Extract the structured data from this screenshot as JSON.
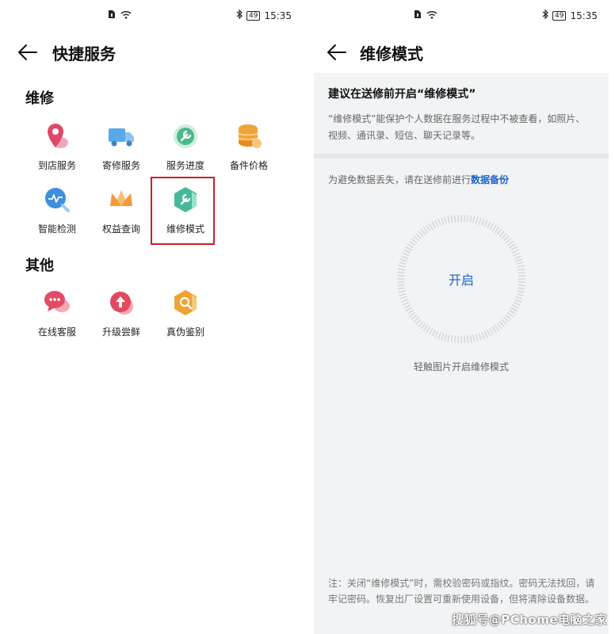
{
  "status_bar": {
    "time": "15:35",
    "battery": "49"
  },
  "left": {
    "title": "快捷服务",
    "sections": {
      "repair": {
        "title": "维修",
        "items": [
          "到店服务",
          "寄修服务",
          "服务进度",
          "备件价格",
          "智能检测",
          "权益查询",
          "维修模式"
        ]
      },
      "other": {
        "title": "其他",
        "items": [
          "在线客服",
          "升级尝鲜",
          "真伪鉴别"
        ]
      }
    }
  },
  "right": {
    "title": "维修模式",
    "headline": "建议在送修前开启“维修模式”",
    "description": "“维修模式”能保护个人数据在服务过程中不被查看，如照片、视频、通讯录、短信、聊天记录等。",
    "backup_prefix": "为避免数据丢失，请在送修前进行",
    "backup_link": "数据备份",
    "enable_label": "开启",
    "enable_hint": "轻触图片开启维修模式",
    "note": "注：关闭“维修模式”时，需校验密码或指纹。密码无法找回，请牢记密码。恢复出厂设置可重新使用设备，但将清除设备数据。"
  },
  "watermark": "搜狐号@PChome电脑之家",
  "colors": {
    "accent": "#1f62c8",
    "highlight": "#d21c24"
  }
}
